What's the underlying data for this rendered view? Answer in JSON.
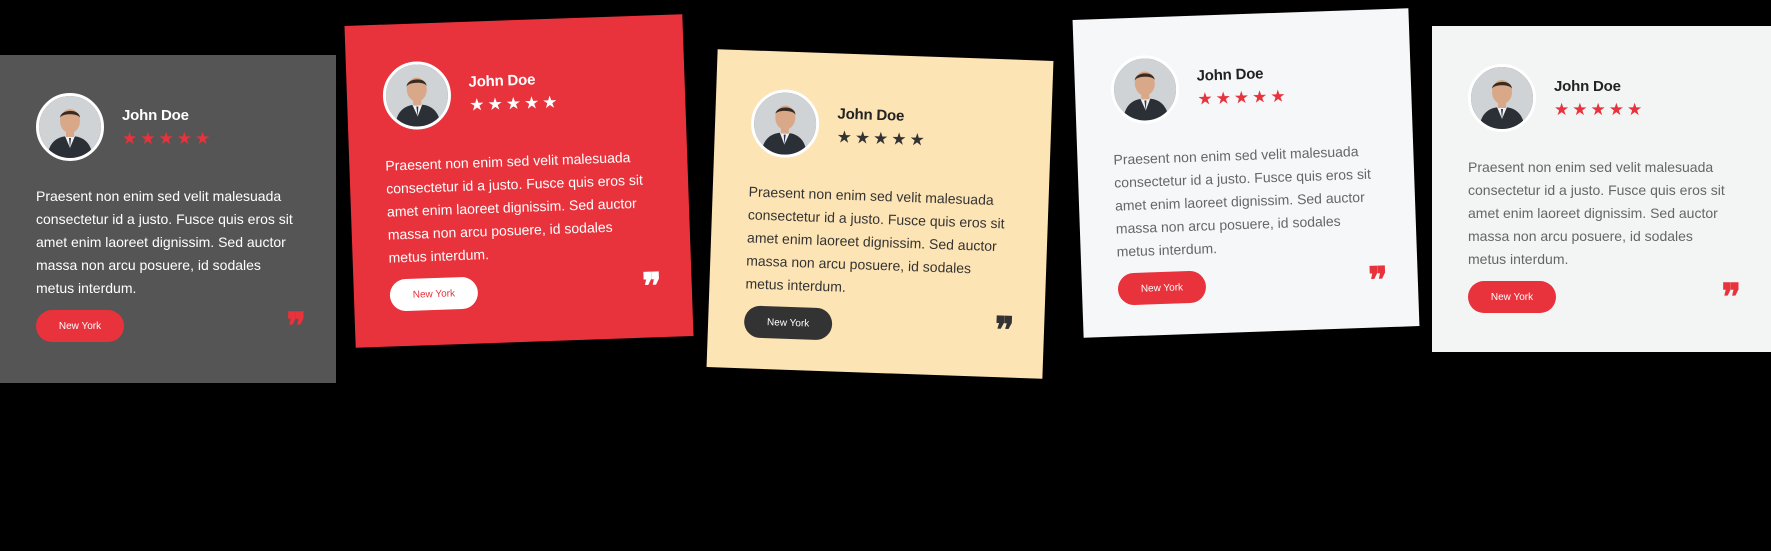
{
  "cards": [
    {
      "name": "John Doe",
      "stars": "★★★★★",
      "text": "Praesent non enim sed velit malesuada consectetur id a justo. Fusce quis eros sit amet enim laoreet dignissim. Sed auctor massa non arcu posuere, id sodales metus interdum.",
      "city": "New York",
      "quote": "❞",
      "rating": 5,
      "colors": {
        "background": "#555555",
        "accent": "#e8323c"
      }
    },
    {
      "name": "John Doe",
      "stars": "★★★★★",
      "text": "Praesent non enim sed velit malesuada consectetur id a justo. Fusce quis eros sit amet enim laoreet dignissim. Sed auctor massa non arcu posuere, id sodales metus interdum.",
      "city": "New York",
      "quote": "❞",
      "rating": 5,
      "colors": {
        "background": "#e8323c",
        "accent": "#ffffff"
      }
    },
    {
      "name": "John Doe",
      "stars": "★★★★★",
      "text": "Praesent non enim sed velit malesuada consectetur id a justo. Fusce quis eros sit amet enim laoreet dignissim. Sed auctor massa non arcu posuere, id sodales metus interdum.",
      "city": "New York",
      "quote": "❞",
      "rating": 5,
      "colors": {
        "background": "#fde4b4",
        "accent": "#333333"
      }
    },
    {
      "name": "John Doe",
      "stars": "★★★★★",
      "text": "Praesent non enim sed velit malesuada consectetur id a justo. Fusce quis eros sit amet enim laoreet dignissim. Sed auctor massa non arcu posuere, id sodales metus interdum.",
      "city": "New York",
      "quote": "❞",
      "rating": 5,
      "colors": {
        "background": "#f5f7f9",
        "accent": "#e8323c"
      }
    },
    {
      "name": "John Doe",
      "stars": "★★★★★",
      "text": "Praesent non enim sed velit malesuada consectetur id a justo. Fusce quis eros sit amet enim laoreet dignissim. Sed auctor massa non arcu posuere, id sodales metus interdum.",
      "city": "New York",
      "quote": "❞",
      "rating": 5,
      "colors": {
        "background": "#f3f4f4",
        "accent": "#e8323c"
      }
    }
  ],
  "icons": {
    "avatar": "person-avatar",
    "star": "star-icon",
    "quote": "quote-icon"
  }
}
